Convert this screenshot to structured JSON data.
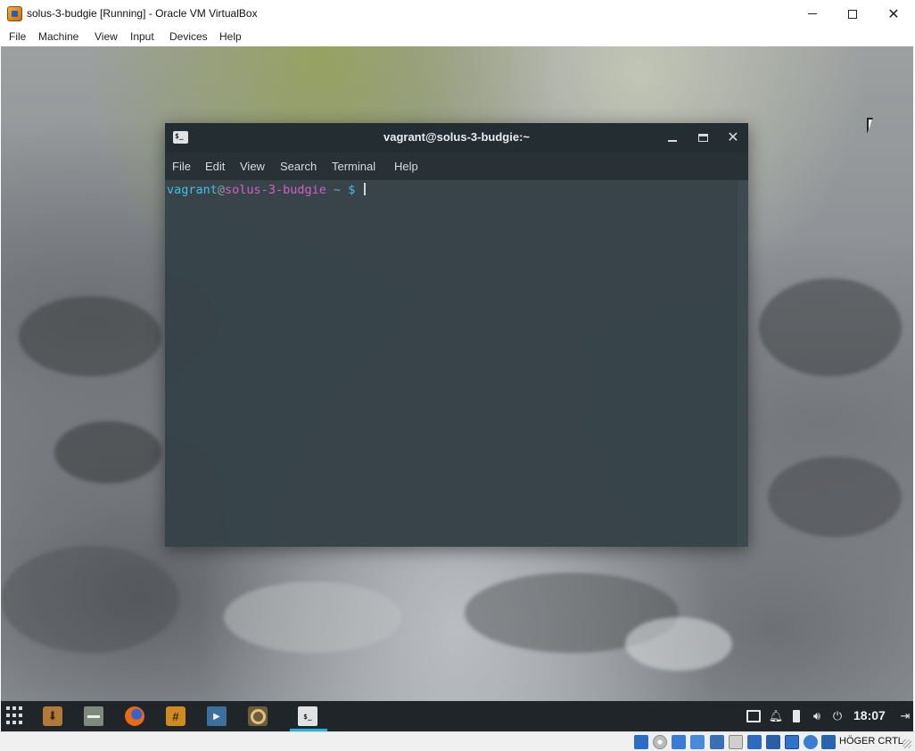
{
  "host_window": {
    "title": "solus-3-budgie [Running] - Oracle VM VirtualBox",
    "menu": [
      "File",
      "Machine",
      "View",
      "Input",
      "Devices",
      "Help"
    ],
    "controls": {
      "minimize": "minimize-icon",
      "maximize": "maximize-icon",
      "close": "✕"
    }
  },
  "terminal": {
    "title": "vagrant@solus-3-budgie:~",
    "icon_text": "$_",
    "menu": [
      "File",
      "Edit",
      "View",
      "Search",
      "Terminal",
      "Help"
    ],
    "prompt": {
      "user": "vagrant",
      "at": "@",
      "host": "solus-3-budgie",
      "path": " ~ ",
      "symbol": "$"
    },
    "colors": {
      "user": "#3fc0e6",
      "host": "#d35fc4",
      "background": "#2f393e"
    }
  },
  "panel": {
    "launchers": [
      "apps-grid-icon",
      "software-center-icon",
      "files-icon",
      "firefox-icon",
      "hexchat-icon",
      "video-player-icon",
      "audio-player-icon",
      "terminal-icon"
    ],
    "hexchat_glyph": "#",
    "terminal_glyph": "$_",
    "tray": [
      "display-icon",
      "notification-bell-icon",
      "battery-icon",
      "volume-icon",
      "power-icon"
    ],
    "clock": "18:07",
    "logout_glyph": "⇥",
    "accent": "#26b5da"
  },
  "status_bar": {
    "host_key": "HÖGER CRTL",
    "icons": [
      "hard-disk-icon",
      "optical-drive-icon",
      "audio-icon",
      "network-icon",
      "usb-icon",
      "shared-folders-icon",
      "display-icon",
      "video-capture-icon",
      "vrde-icon",
      "cpu-icon",
      "mouse-integration-icon",
      "keyboard-capture-icon"
    ]
  }
}
